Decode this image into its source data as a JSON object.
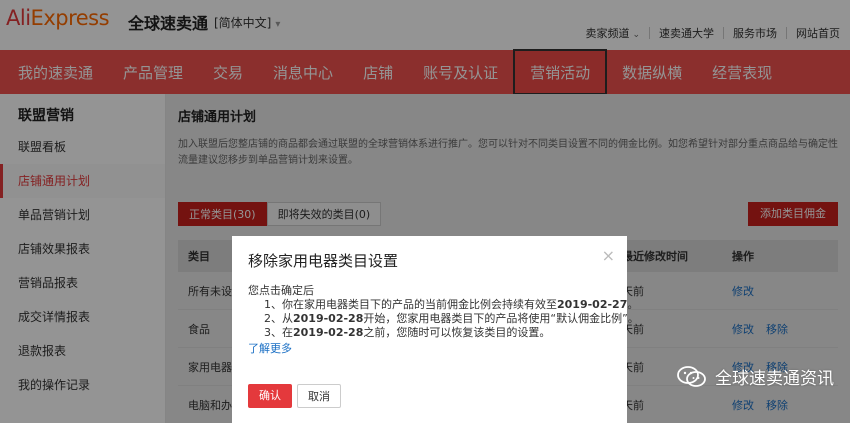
{
  "header": {
    "logo": "AliExpress",
    "logo_sub": "全球速卖通",
    "language": "[简体中文]",
    "links": [
      "卖家频道",
      "速卖通大学",
      "服务市场",
      "网站首页"
    ]
  },
  "nav": {
    "items": [
      "我的速卖通",
      "产品管理",
      "交易",
      "消息中心",
      "店铺",
      "账号及认证",
      "营销活动",
      "数据纵横",
      "经营表现"
    ],
    "active_index": 6
  },
  "sidebar": {
    "title": "联盟营销",
    "items": [
      "联盟看板",
      "店铺通用计划",
      "单品营销计划",
      "店铺效果报表",
      "营销品报表",
      "成交详情报表",
      "退款报表",
      "我的操作记录"
    ],
    "active_index": 1
  },
  "content": {
    "title": "店铺通用计划",
    "description": "加入联盟后您整店铺的商品都会通过联盟的全球营销体系进行推广。您可以针对不同类目设置不同的佣金比例。如您希望针对部分重点商品给与确定性流量建议您移步到单品营销计划来设置。",
    "tabs": [
      "正常类目(30)",
      "即将失效的类目(0)"
    ],
    "add_button": "添加类目佣金",
    "columns": [
      "类目",
      "",
      "最近修改时间",
      "操作"
    ],
    "rows": [
      {
        "category": "所有未设",
        "date": "天前",
        "actions": [
          "修改"
        ]
      },
      {
        "category": "食品",
        "date": "天前",
        "actions": [
          "修改",
          "移除"
        ]
      },
      {
        "category": "家用电器",
        "date": "天前",
        "actions": [
          "修改",
          "移除"
        ]
      },
      {
        "category": "电脑和办",
        "date": "天前",
        "actions": [
          "修改",
          "移除"
        ]
      }
    ]
  },
  "dialog": {
    "title": "移除家用电器类目设置",
    "close": "×",
    "intro": "您点击确定后",
    "line1_pre": "1、你在家用电器类目下的产品的当前佣金比例会持续有效至",
    "line1_date": "2019-02-27",
    "line1_post": "。",
    "line2_pre": "2、从",
    "line2_date": "2019-02-28",
    "line2_post": "开始，您家用电器类目下的产品将使用“默认佣金比例”。",
    "line3_pre": "3、在",
    "line3_date": "2019-02-28",
    "line3_post": "之前，您随时可以恢复该类目的设置。",
    "more_link": "了解更多",
    "ok_button": "确认",
    "cancel_button": "取消"
  },
  "watermark": {
    "text": "全球速卖通资讯",
    "icon": "wechat-icon"
  }
}
